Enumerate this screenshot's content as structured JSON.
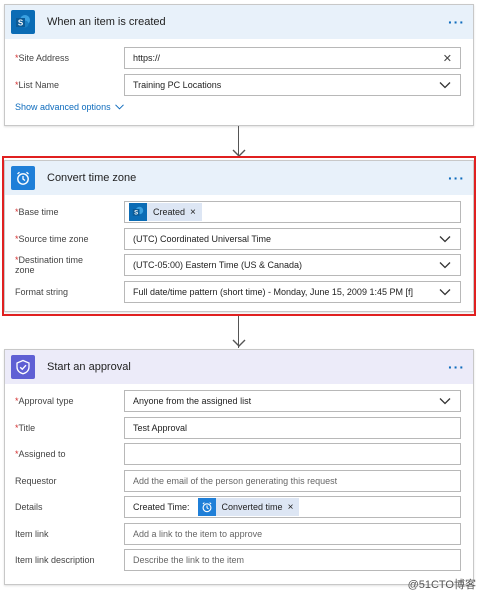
{
  "trigger": {
    "title": "When an item is created",
    "site_address_label": "Site Address",
    "site_address_value": "https://",
    "list_name_label": "List Name",
    "list_name_value": "Training PC Locations",
    "advanced_label": "Show advanced options"
  },
  "convert": {
    "title": "Convert time zone",
    "base_time_label": "Base time",
    "base_time_token": "Created",
    "source_tz_label": "Source time zone",
    "source_tz_value": "(UTC) Coordinated Universal Time",
    "dest_tz_label_1": "Destination time",
    "dest_tz_label_2": "zone",
    "dest_tz_value": "(UTC-05:00) Eastern Time (US & Canada)",
    "format_label": "Format string",
    "format_value": "Full date/time pattern (short time) - Monday, June 15, 2009 1:45 PM [f]"
  },
  "approval": {
    "title": "Start an approval",
    "type_label": "Approval type",
    "type_value": "Anyone from the assigned list",
    "title_label": "Title",
    "title_value": "Test Approval",
    "assigned_label": "Assigned to",
    "assigned_value": "",
    "requestor_label": "Requestor",
    "requestor_placeholder": "Add the email of the person generating this request",
    "details_label": "Details",
    "details_prefix": "Created Time:",
    "details_token": "Converted time",
    "item_link_label": "Item link",
    "item_link_placeholder": "Add a link to the item to approve",
    "item_link_desc_label": "Item link description",
    "item_link_desc_placeholder": "Describe the link to the item"
  },
  "required_marker": "*",
  "more_label": "···",
  "clear_label": "✕",
  "token_close": "×",
  "watermark": "@51CTO博客",
  "colors": {
    "sharepoint": "#0b6cb5",
    "sharepoint_header": "#e8f1fa",
    "datetime": "#1f7fd8",
    "approval": "#5f5fd4",
    "approval_header": "#ecebf9",
    "link": "#0f6cbd",
    "highlight": "#e02020"
  },
  "icons": [
    "sharepoint-icon",
    "clock-icon",
    "approval-icon",
    "chevron-down-icon",
    "clear-icon",
    "more-icon"
  ]
}
